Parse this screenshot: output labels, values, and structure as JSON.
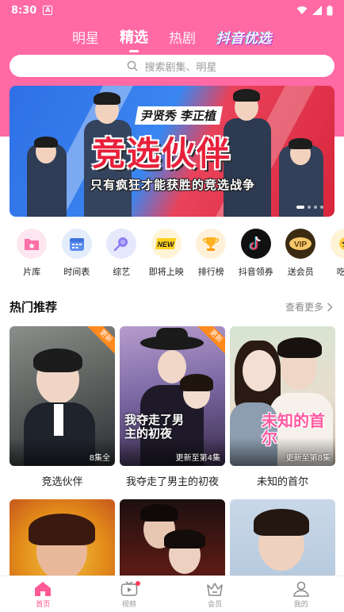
{
  "status": {
    "time": "8:30",
    "app_icon_letter": "A"
  },
  "top_tabs": [
    {
      "label": "明星",
      "active": false
    },
    {
      "label": "精选",
      "active": true
    },
    {
      "label": "热剧",
      "active": false
    },
    {
      "label": "抖音优选",
      "active": false
    }
  ],
  "search": {
    "placeholder": "搜索剧集、明星"
  },
  "banner": {
    "cast": "尹贤秀 李正植",
    "title": "竞选伙伴",
    "subtitle": "只有疯狂才能获胜的竞选战争"
  },
  "categories": [
    {
      "label": "片库",
      "icon": "library-icon",
      "bg": "#fde6ef"
    },
    {
      "label": "时间表",
      "icon": "calendar-icon",
      "bg": "#e3ecfb"
    },
    {
      "label": "综艺",
      "icon": "lollipop-icon",
      "bg": "#e6e8fb"
    },
    {
      "label": "即将上映",
      "icon": "new-badge-icon",
      "bg": "#fff4d6"
    },
    {
      "label": "排行榜",
      "icon": "trophy-icon",
      "bg": "#fff1d9"
    },
    {
      "label": "抖音领券",
      "icon": "douyin-icon",
      "bg": "#111111"
    },
    {
      "label": "送会员",
      "icon": "vip-icon",
      "bg": "#3b2a12"
    },
    {
      "label": "吃瓜",
      "icon": "melon-icon",
      "bg": "#fff3d6"
    }
  ],
  "section": {
    "title": "热门推荐",
    "more": "查看更多"
  },
  "cards": [
    {
      "title": "竞选伙伴",
      "badge": "更新",
      "tag": "8集全",
      "poster_text": ""
    },
    {
      "title": "我夺走了男主的初夜",
      "badge": "更新",
      "tag": "更新至第4集",
      "poster_text": "我夺走了男主的初夜"
    },
    {
      "title": "未知的首尔",
      "badge": "",
      "tag": "更新至第8集",
      "poster_text": "未知的首尔"
    },
    {
      "title": "",
      "badge": "",
      "tag": "",
      "poster_text": ""
    },
    {
      "title": "",
      "badge": "",
      "tag": "",
      "poster_text": ""
    },
    {
      "title": "",
      "badge": "",
      "tag": "",
      "poster_text": ""
    }
  ],
  "nav": [
    {
      "label": "首页",
      "icon": "home-icon",
      "active": true
    },
    {
      "label": "视频",
      "icon": "tv-icon",
      "active": false
    },
    {
      "label": "会员",
      "icon": "crown-icon",
      "active": false
    },
    {
      "label": "我的",
      "icon": "profile-icon",
      "active": false
    }
  ],
  "colors": {
    "accent": "#ff69a4",
    "nav_active": "#ff4f8f",
    "badge": "#ff8a1e"
  }
}
